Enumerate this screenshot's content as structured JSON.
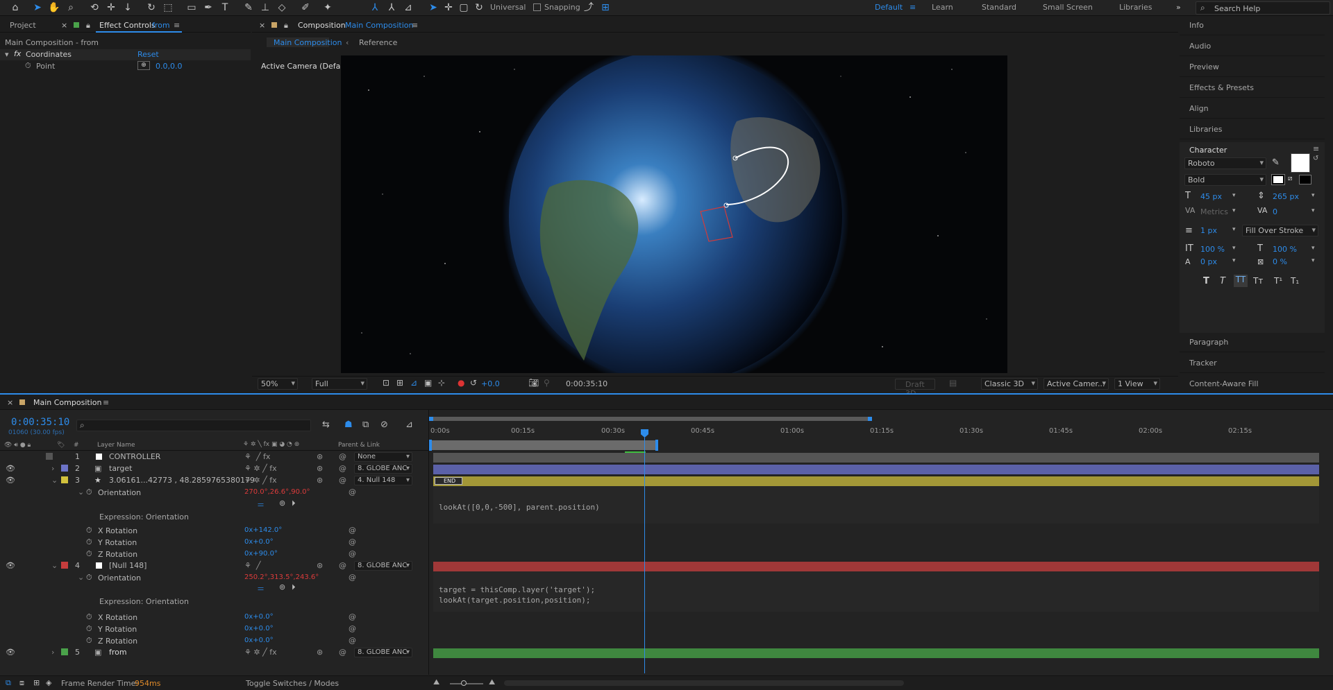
{
  "toolbar": {
    "universal": "Universal",
    "snapping": "Snapping",
    "workspaces": [
      "Default",
      "Learn",
      "Standard",
      "Small Screen",
      "Libraries"
    ],
    "search": "Search Help"
  },
  "left_panel": {
    "tab_project": "Project",
    "tab_effect": "Effect Controls",
    "tab_effect_target": "from",
    "subtitle": "Main Composition - from",
    "fx_name": "Coordinates",
    "fx_reset": "Reset",
    "point_label": "Point",
    "point_value": "0.0,0.0"
  },
  "comp_panel": {
    "tab_label": "Composition",
    "tab_name": "Main Composition",
    "subtab_main": "Main Composition",
    "subtab_ref": "Reference",
    "camera_label": "Active Camera (Default)",
    "zoom": "50%",
    "resolution": "Full",
    "exposure": "+0.0",
    "timecode": "0:00:35:10",
    "draft3d": "Draft 3D",
    "renderer": "Classic 3D",
    "camera": "Active Camer...",
    "views": "1 View"
  },
  "right_panel": {
    "items_top": [
      "Info",
      "Audio",
      "Preview",
      "Effects & Presets",
      "Align",
      "Libraries"
    ],
    "character_title": "Character",
    "font": "Roboto",
    "style": "Bold",
    "font_size": "45 px",
    "leading": "265 px",
    "kerning": "Metrics",
    "tracking": "0",
    "stroke_width": "1 px",
    "stroke_mode": "Fill Over Stroke",
    "vscale": "100 %",
    "hscale": "100 %",
    "baseline": "0 px",
    "tsume": "0 %",
    "items_bottom": [
      "Paragraph",
      "Tracker",
      "Content-Aware Fill"
    ],
    "fill_color": "#ffffff",
    "stroke_color": "#000000"
  },
  "timeline": {
    "tab": "Main Composition",
    "timecode": "0:00:35:10",
    "frame_info": "01060 (30.00 fps)",
    "col_layer": "Layer Name",
    "col_parent": "Parent & Link",
    "ruler": [
      "0:00s",
      "00:15s",
      "00:30s",
      "00:45s",
      "01:00s",
      "01:15s",
      "01:30s",
      "01:45s",
      "02:00s",
      "02:15s"
    ],
    "layers": [
      {
        "num": "1",
        "name": "CONTROLLER",
        "color": "#7a7a7a",
        "parent": "None"
      },
      {
        "num": "2",
        "name": "target",
        "color": "#6d74c7",
        "parent": "8. GLOBE ANC"
      },
      {
        "num": "3",
        "name": "3.06161...42773 , 48.2859765380179",
        "color": "#d2c13d",
        "parent": "4. Null 148"
      },
      {
        "num": "4",
        "name": "[Null 148]",
        "color": "#c53d3d",
        "parent": "8. GLOBE ANC"
      },
      {
        "num": "5",
        "name": "from",
        "color": "#4aa24a",
        "parent": "8. GLOBE ANC"
      }
    ],
    "props": {
      "orientation": "Orientation",
      "expr": "Expression: Orientation",
      "xrot": "X Rotation",
      "yrot": "Y Rotation",
      "zrot": "Z Rotation",
      "l3_orient": "270.0°,26.6°,90.0°",
      "l3_x": "0x+142.0°",
      "l3_y": "0x+0.0°",
      "l3_z": "0x+90.0°",
      "l4_orient": "250.2°,313.5°,243.6°",
      "l4_x": "0x+0.0°",
      "l4_y": "0x+0.0°",
      "l4_z": "0x+0.0°"
    },
    "code3": "lookAt([0,0,-500], parent.position)",
    "code4": "target = thisComp.layer('target');\nlookAt(target.position,position);",
    "end_marker": "END",
    "render_label": "Frame Render Time:",
    "render_value": "954ms",
    "toggle": "Toggle Switches / Modes"
  }
}
